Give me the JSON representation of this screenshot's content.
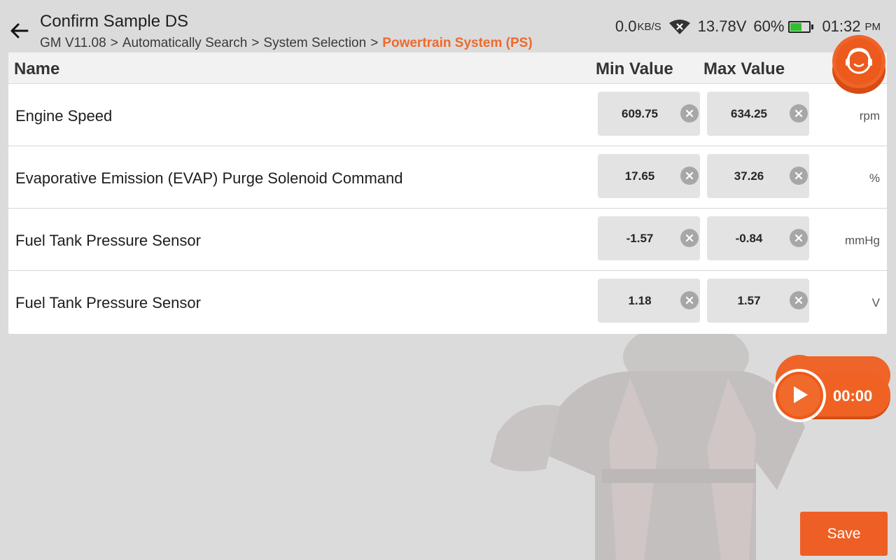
{
  "header": {
    "title": "Confirm Sample DS",
    "breadcrumb": [
      "GM V11.08",
      "Automatically Search",
      "System Selection"
    ],
    "breadcrumb_active": "Powertrain System (PS)",
    "breadcrumb_sep": ">"
  },
  "status_bar": {
    "net_speed": "0.0",
    "net_unit": "KB/S",
    "voltage": "13.78V",
    "battery_pct": "60%",
    "battery_level": 0.6,
    "time": "01:32",
    "ampm": "PM"
  },
  "table": {
    "columns": {
      "name": "Name",
      "min": "Min Value",
      "max": "Max Value"
    },
    "rows": [
      {
        "name": "Engine Speed",
        "min": "609.75",
        "max": "634.25",
        "unit": "rpm"
      },
      {
        "name": "Evaporative Emission (EVAP) Purge Solenoid Command",
        "min": "17.65",
        "max": "37.26",
        "unit": "%"
      },
      {
        "name": "Fuel Tank Pressure Sensor",
        "min": "-1.57",
        "max": "-0.84",
        "unit": "mmHg"
      },
      {
        "name": "Fuel Tank Pressure Sensor",
        "min": "1.18",
        "max": "1.57",
        "unit": "V"
      }
    ]
  },
  "recorder": {
    "timer": "00:00"
  },
  "actions": {
    "save_label": "Save"
  },
  "colors": {
    "accent": "#ee5f25",
    "breadcrumb_active": "#ee6a2c",
    "battery": "#2fbf2f"
  },
  "icons": {
    "back": "arrow-left-icon",
    "wifi": "wifi-off-icon",
    "battery": "battery-icon",
    "clear": "close-circle-icon",
    "support": "headset-support-icon",
    "play": "play-icon"
  }
}
